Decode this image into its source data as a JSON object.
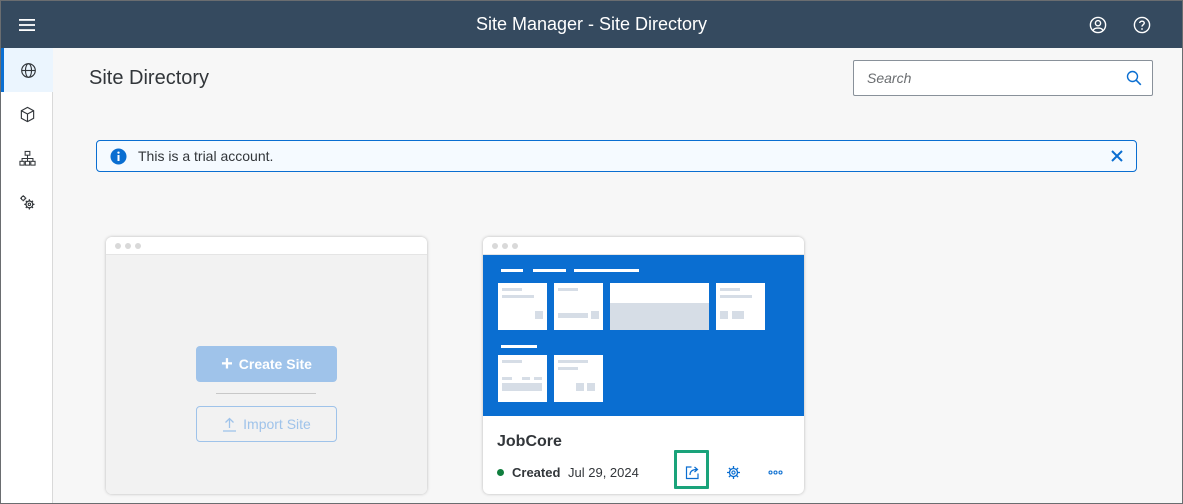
{
  "shell": {
    "title": "Site Manager - Site Directory",
    "menu_icon": "hamburger-icon",
    "profile_icon": "user-profile-icon",
    "help_icon": "help-icon"
  },
  "sidenav": {
    "items": [
      {
        "icon": "globe-icon",
        "selected": true
      },
      {
        "icon": "content-cube-icon",
        "selected": false
      },
      {
        "icon": "hierarchy-icon",
        "selected": false
      },
      {
        "icon": "settings-gears-icon",
        "selected": false
      }
    ]
  },
  "page": {
    "title": "Site Directory"
  },
  "search": {
    "placeholder": "Search",
    "value": ""
  },
  "message": {
    "text": "This is a trial account.",
    "type": "information"
  },
  "create_card": {
    "create_label": "Create Site",
    "import_label": "Import Site"
  },
  "site_card": {
    "name": "JobCore",
    "status": "Created",
    "date": "Jul 29, 2024"
  },
  "colors": {
    "shell_bg": "#354a5f",
    "accent": "#0a6ed1",
    "status_success": "#107e3e",
    "highlight": "#1aa37a"
  }
}
